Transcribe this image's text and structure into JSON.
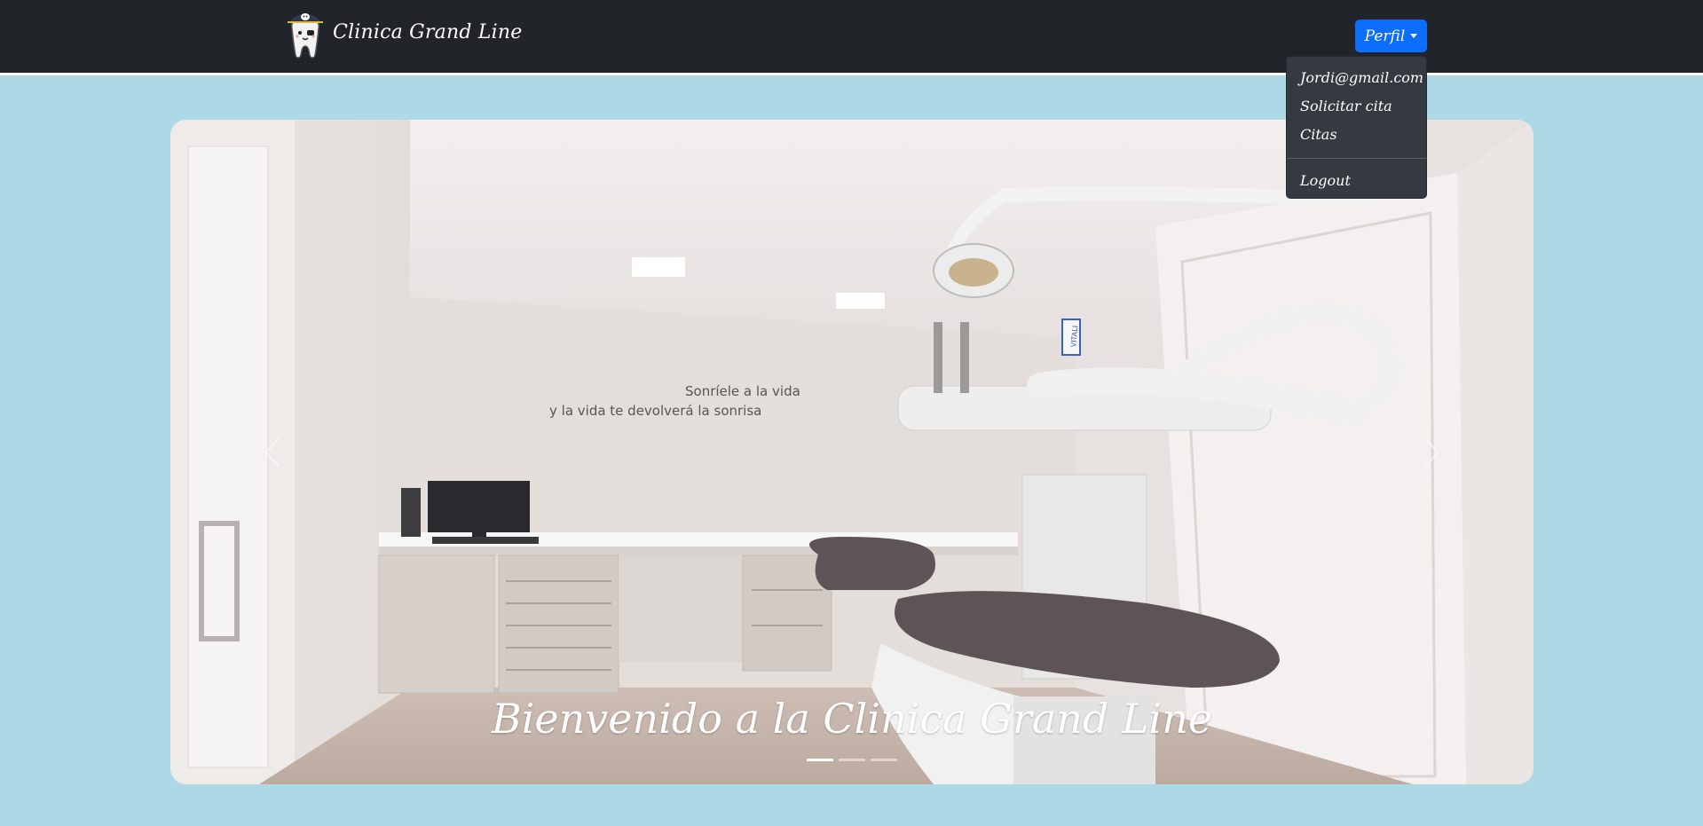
{
  "navbar": {
    "brand": "Clinica Grand Line",
    "perfil_label": "Perfil"
  },
  "dropdown": {
    "items": [
      "Jordi@gmail.com",
      "Solicitar cita",
      "Citas"
    ],
    "logout": "Logout"
  },
  "carousel": {
    "caption": "Bienvenido a la Clinica Grand Line",
    "wall_text_line1": "Sonríele a la vida",
    "wall_text_line2": "y la vida te devolverá la sonrisa",
    "equipment_label": "VITALI",
    "slide_count": 3,
    "active_slide": 1,
    "prev_icon": "chevron-left-icon",
    "next_icon": "chevron-right-icon"
  },
  "colors": {
    "page_background": "#add8e6",
    "navbar_background": "#212529",
    "perfil_button": "#0d6efd",
    "dropdown_background": "#343a40"
  }
}
